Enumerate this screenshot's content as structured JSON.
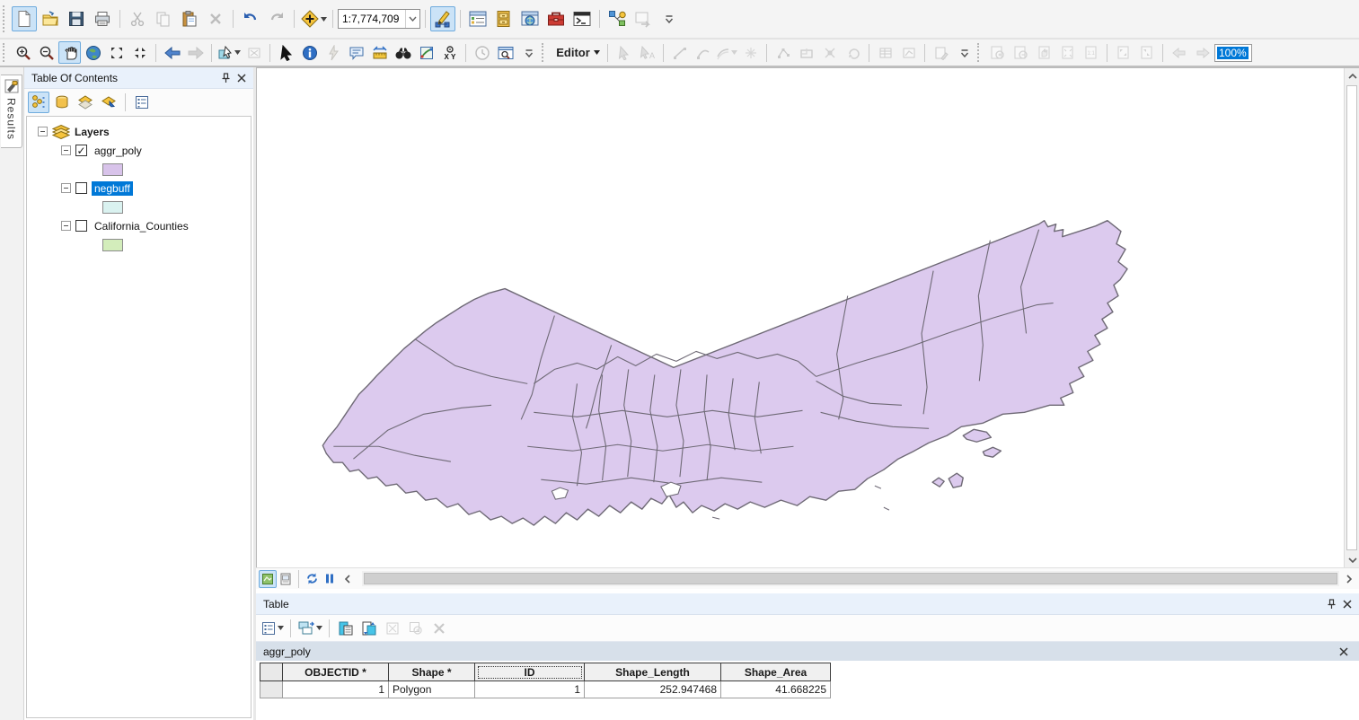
{
  "colors": {
    "toolbar_bg": "#f4f4f4",
    "selected_tool_bg": "#cbe3f7",
    "selected_tool_border": "#6fabdd",
    "selection_blue": "#0078d7",
    "panel_title_bg": "#e9f1fb",
    "map_fill": "#dccaee",
    "map_stroke": "#6f6a76",
    "scrollbar_track": "#f0f0f0",
    "tabbar_bg": "#d7e0ea",
    "grid_header_bg": "#f0f0f0"
  },
  "toolbar_main": {
    "scale_value": "1:7,774,709"
  },
  "toolbar_editor": {
    "label": "Editor"
  },
  "toolbar_layout": {
    "zoom_value": "100%"
  },
  "results_tab": {
    "label": "Results"
  },
  "toc": {
    "title": "Table Of Contents",
    "root_label": "Layers",
    "layers": [
      {
        "name": "aggr_poly",
        "checked": true,
        "selected": false,
        "swatch": "#d8c3ea",
        "checkmark": "✓"
      },
      {
        "name": "negbuff",
        "checked": false,
        "selected": true,
        "swatch": "#daf2f0",
        "checkmark": ""
      },
      {
        "name": "California_Counties",
        "checked": false,
        "selected": false,
        "swatch": "#d3edbb",
        "checkmark": ""
      }
    ]
  },
  "table_panel": {
    "title": "Table",
    "tab": "aggr_poly",
    "columns": [
      "OBJECTID *",
      "Shape *",
      "ID",
      "Shape_Length",
      "Shape_Area"
    ],
    "rows": [
      [
        "1",
        "Polygon",
        "1",
        "252.947468",
        "41.668225"
      ]
    ]
  }
}
